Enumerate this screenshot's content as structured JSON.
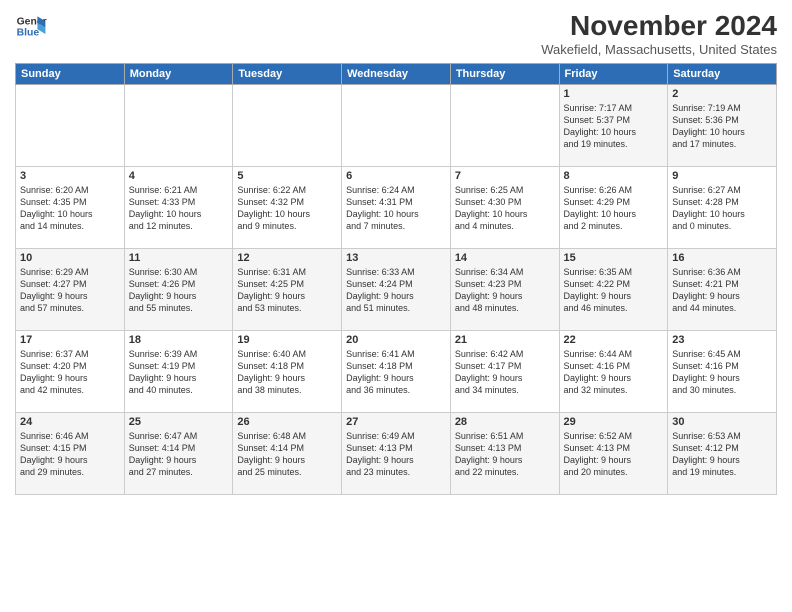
{
  "logo": {
    "line1": "General",
    "line2": "Blue"
  },
  "title": "November 2024",
  "location": "Wakefield, Massachusetts, United States",
  "days_of_week": [
    "Sunday",
    "Monday",
    "Tuesday",
    "Wednesday",
    "Thursday",
    "Friday",
    "Saturday"
  ],
  "weeks": [
    [
      {
        "day": "",
        "info": ""
      },
      {
        "day": "",
        "info": ""
      },
      {
        "day": "",
        "info": ""
      },
      {
        "day": "",
        "info": ""
      },
      {
        "day": "",
        "info": ""
      },
      {
        "day": "1",
        "info": "Sunrise: 7:17 AM\nSunset: 5:37 PM\nDaylight: 10 hours\nand 19 minutes."
      },
      {
        "day": "2",
        "info": "Sunrise: 7:19 AM\nSunset: 5:36 PM\nDaylight: 10 hours\nand 17 minutes."
      }
    ],
    [
      {
        "day": "3",
        "info": "Sunrise: 6:20 AM\nSunset: 4:35 PM\nDaylight: 10 hours\nand 14 minutes."
      },
      {
        "day": "4",
        "info": "Sunrise: 6:21 AM\nSunset: 4:33 PM\nDaylight: 10 hours\nand 12 minutes."
      },
      {
        "day": "5",
        "info": "Sunrise: 6:22 AM\nSunset: 4:32 PM\nDaylight: 10 hours\nand 9 minutes."
      },
      {
        "day": "6",
        "info": "Sunrise: 6:24 AM\nSunset: 4:31 PM\nDaylight: 10 hours\nand 7 minutes."
      },
      {
        "day": "7",
        "info": "Sunrise: 6:25 AM\nSunset: 4:30 PM\nDaylight: 10 hours\nand 4 minutes."
      },
      {
        "day": "8",
        "info": "Sunrise: 6:26 AM\nSunset: 4:29 PM\nDaylight: 10 hours\nand 2 minutes."
      },
      {
        "day": "9",
        "info": "Sunrise: 6:27 AM\nSunset: 4:28 PM\nDaylight: 10 hours\nand 0 minutes."
      }
    ],
    [
      {
        "day": "10",
        "info": "Sunrise: 6:29 AM\nSunset: 4:27 PM\nDaylight: 9 hours\nand 57 minutes."
      },
      {
        "day": "11",
        "info": "Sunrise: 6:30 AM\nSunset: 4:26 PM\nDaylight: 9 hours\nand 55 minutes."
      },
      {
        "day": "12",
        "info": "Sunrise: 6:31 AM\nSunset: 4:25 PM\nDaylight: 9 hours\nand 53 minutes."
      },
      {
        "day": "13",
        "info": "Sunrise: 6:33 AM\nSunset: 4:24 PM\nDaylight: 9 hours\nand 51 minutes."
      },
      {
        "day": "14",
        "info": "Sunrise: 6:34 AM\nSunset: 4:23 PM\nDaylight: 9 hours\nand 48 minutes."
      },
      {
        "day": "15",
        "info": "Sunrise: 6:35 AM\nSunset: 4:22 PM\nDaylight: 9 hours\nand 46 minutes."
      },
      {
        "day": "16",
        "info": "Sunrise: 6:36 AM\nSunset: 4:21 PM\nDaylight: 9 hours\nand 44 minutes."
      }
    ],
    [
      {
        "day": "17",
        "info": "Sunrise: 6:37 AM\nSunset: 4:20 PM\nDaylight: 9 hours\nand 42 minutes."
      },
      {
        "day": "18",
        "info": "Sunrise: 6:39 AM\nSunset: 4:19 PM\nDaylight: 9 hours\nand 40 minutes."
      },
      {
        "day": "19",
        "info": "Sunrise: 6:40 AM\nSunset: 4:18 PM\nDaylight: 9 hours\nand 38 minutes."
      },
      {
        "day": "20",
        "info": "Sunrise: 6:41 AM\nSunset: 4:18 PM\nDaylight: 9 hours\nand 36 minutes."
      },
      {
        "day": "21",
        "info": "Sunrise: 6:42 AM\nSunset: 4:17 PM\nDaylight: 9 hours\nand 34 minutes."
      },
      {
        "day": "22",
        "info": "Sunrise: 6:44 AM\nSunset: 4:16 PM\nDaylight: 9 hours\nand 32 minutes."
      },
      {
        "day": "23",
        "info": "Sunrise: 6:45 AM\nSunset: 4:16 PM\nDaylight: 9 hours\nand 30 minutes."
      }
    ],
    [
      {
        "day": "24",
        "info": "Sunrise: 6:46 AM\nSunset: 4:15 PM\nDaylight: 9 hours\nand 29 minutes."
      },
      {
        "day": "25",
        "info": "Sunrise: 6:47 AM\nSunset: 4:14 PM\nDaylight: 9 hours\nand 27 minutes."
      },
      {
        "day": "26",
        "info": "Sunrise: 6:48 AM\nSunset: 4:14 PM\nDaylight: 9 hours\nand 25 minutes."
      },
      {
        "day": "27",
        "info": "Sunrise: 6:49 AM\nSunset: 4:13 PM\nDaylight: 9 hours\nand 23 minutes."
      },
      {
        "day": "28",
        "info": "Sunrise: 6:51 AM\nSunset: 4:13 PM\nDaylight: 9 hours\nand 22 minutes."
      },
      {
        "day": "29",
        "info": "Sunrise: 6:52 AM\nSunset: 4:13 PM\nDaylight: 9 hours\nand 20 minutes."
      },
      {
        "day": "30",
        "info": "Sunrise: 6:53 AM\nSunset: 4:12 PM\nDaylight: 9 hours\nand 19 minutes."
      }
    ]
  ]
}
